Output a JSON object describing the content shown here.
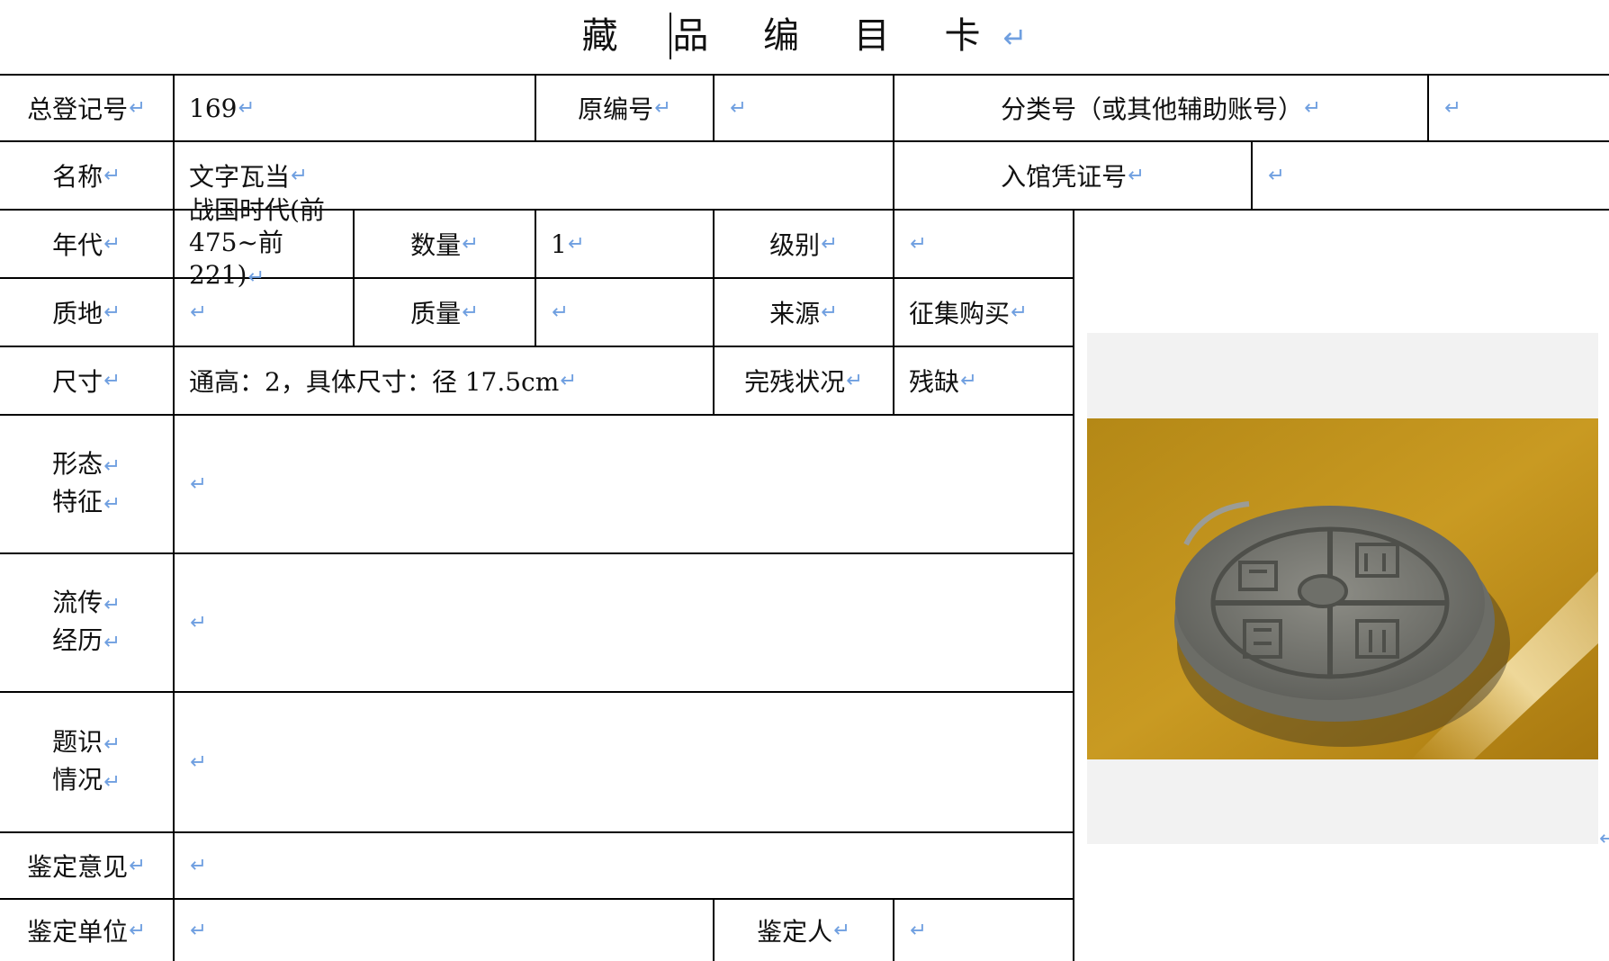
{
  "title": "藏 品 编 目 卡",
  "row1": {
    "total_reg_label": "总登记号",
    "total_reg_value": "169",
    "orig_no_label": "原编号",
    "orig_no_value": "",
    "class_no_label": "分类号（或其他辅助账号）",
    "class_no_value": ""
  },
  "row2": {
    "name_label": "名称",
    "name_value": "文字瓦当",
    "voucher_label": "入馆凭证号",
    "voucher_value": ""
  },
  "row3": {
    "era_label": "年代",
    "era_value_line1": "战国时代(前",
    "era_value_line2": "475~前 221)",
    "qty_label": "数量",
    "qty_value": "1",
    "grade_label": "级别",
    "grade_value": ""
  },
  "row4": {
    "material_label": "质地",
    "material_value": "",
    "weight_label": "质量",
    "weight_value": "",
    "source_label": "来源",
    "source_value": "征集购买"
  },
  "row5": {
    "size_label": "尺寸",
    "size_value": "通高：2，具体尺寸：径 17.5cm",
    "condition_label": "完残状况",
    "condition_value": "残缺"
  },
  "row6": {
    "label_line1": "形态",
    "label_line2": "特征",
    "value": ""
  },
  "row7": {
    "label_line1": "流传",
    "label_line2": "经历",
    "value": ""
  },
  "row8": {
    "label_line1": "题识",
    "label_line2": "情况",
    "value": ""
  },
  "row9": {
    "label": "鉴定意见",
    "value": ""
  },
  "row10": {
    "unit_label": "鉴定单位",
    "unit_value": "",
    "person_label": "鉴定人",
    "person_value": ""
  },
  "photo": {
    "alt": "文字瓦当",
    "bg_color": "#c99a22",
    "tile_color": "#7e7f79"
  },
  "colors": {
    "line": "#000000",
    "return_mark": "#6f9fe0"
  }
}
